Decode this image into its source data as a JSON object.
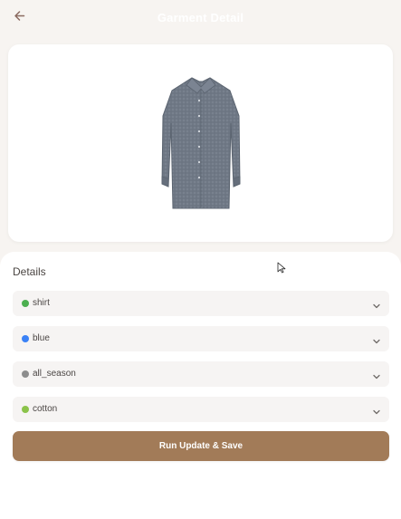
{
  "header": {
    "title": "Garment Detail"
  },
  "details": {
    "title": "Details",
    "fields": [
      {
        "label": "shirt",
        "dot_color": "#4caf50"
      },
      {
        "label": "blue",
        "dot_color": "#3b82f6"
      },
      {
        "label": "all_season",
        "dot_color": "#8d8d8d"
      },
      {
        "label": "cotton",
        "dot_color": "#8bc34a"
      }
    ]
  },
  "actions": {
    "primary_label": "Run Update & Save"
  },
  "icons": {
    "back": "arrow-left",
    "chevron": "chevron-down",
    "cursor": "mouse-pointer"
  }
}
